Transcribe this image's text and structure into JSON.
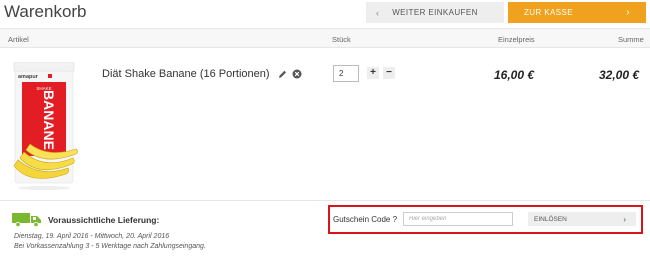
{
  "header": {
    "title": "Warenkorb",
    "continue_label": "WEITER EINKAUFEN",
    "checkout_label": "ZUR KASSE",
    "checkout_color": "#f0a21e"
  },
  "table": {
    "columns": {
      "article": "Artikel",
      "quantity": "Stück",
      "unit_price": "Einzelpreis",
      "total": "Summe"
    }
  },
  "item": {
    "name": "Diät Shake Banane (16 Portionen)",
    "quantity": "2",
    "unit_price": "16,00 €",
    "total_price": "32,00 €",
    "image": {
      "brand": "amapur",
      "line1": "SHAKE",
      "line2": "BANANE",
      "accent_color": "#e31d24"
    }
  },
  "delivery": {
    "title": "Voraussichtliche Lieferung:",
    "dates": "Dienstag, 19. April 2016 - Mittwoch, 20. April 2016",
    "note": "Bei Vorkassenzahlung 3 - 5 Werktage nach Zahlungseingang.",
    "icon_color": "#7cb82f"
  },
  "coupon": {
    "label": "Gutschein Code ?",
    "placeholder": "Hier eingeben",
    "button_label": "EINLÖSEN",
    "highlight_color": "#d9151a"
  }
}
